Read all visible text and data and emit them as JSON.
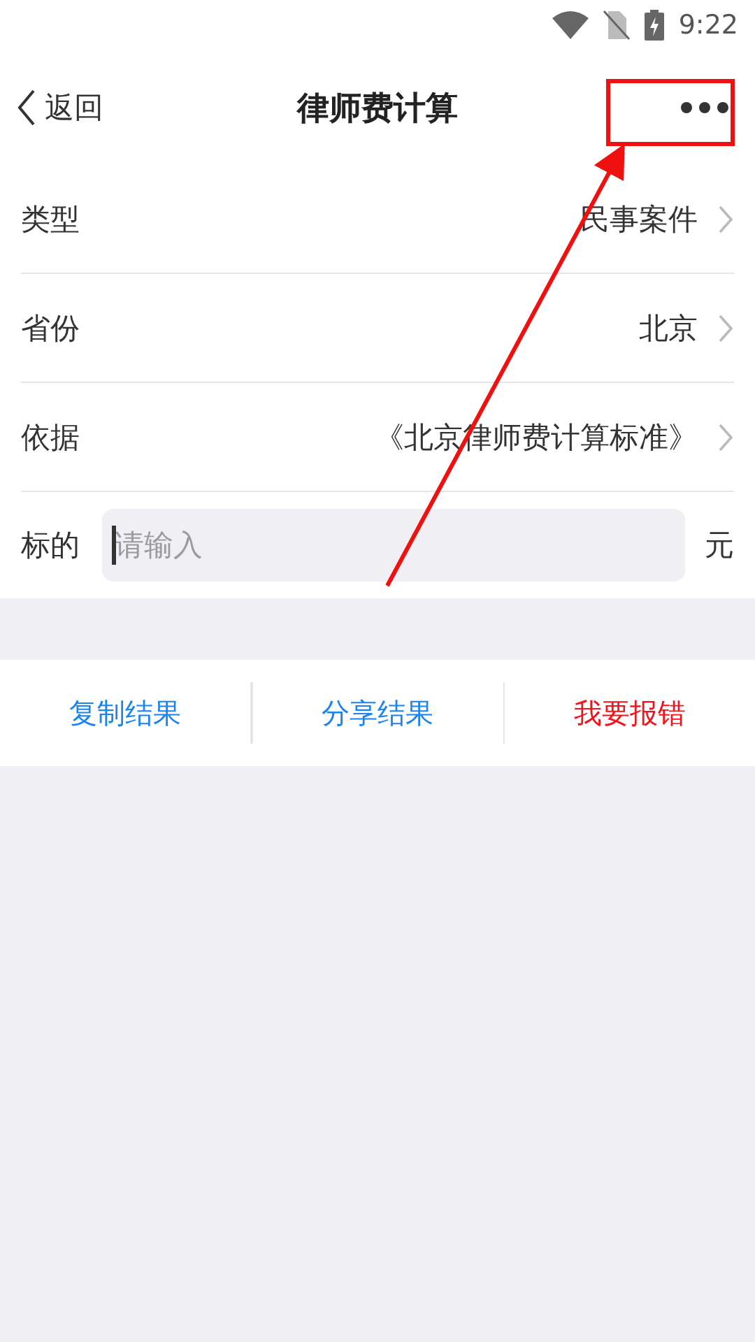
{
  "status_bar": {
    "time": "9:22"
  },
  "nav": {
    "back": "返回",
    "title": "律师费计算"
  },
  "rows": [
    {
      "label": "类型",
      "value": "民事案件"
    },
    {
      "label": "省份",
      "value": "北京"
    },
    {
      "label": "依据",
      "value": "《北京律师费计算标准》"
    }
  ],
  "amount": {
    "label": "标的",
    "placeholder": "请输入",
    "unit": "元"
  },
  "actions": [
    {
      "label": "复制结果",
      "color": "#1a84f0"
    },
    {
      "label": "分享结果",
      "color": "#1a84f0"
    },
    {
      "label": "我要报错",
      "color": "#f5121a"
    }
  ],
  "annotation": {
    "kind": "arrow-to-box"
  }
}
